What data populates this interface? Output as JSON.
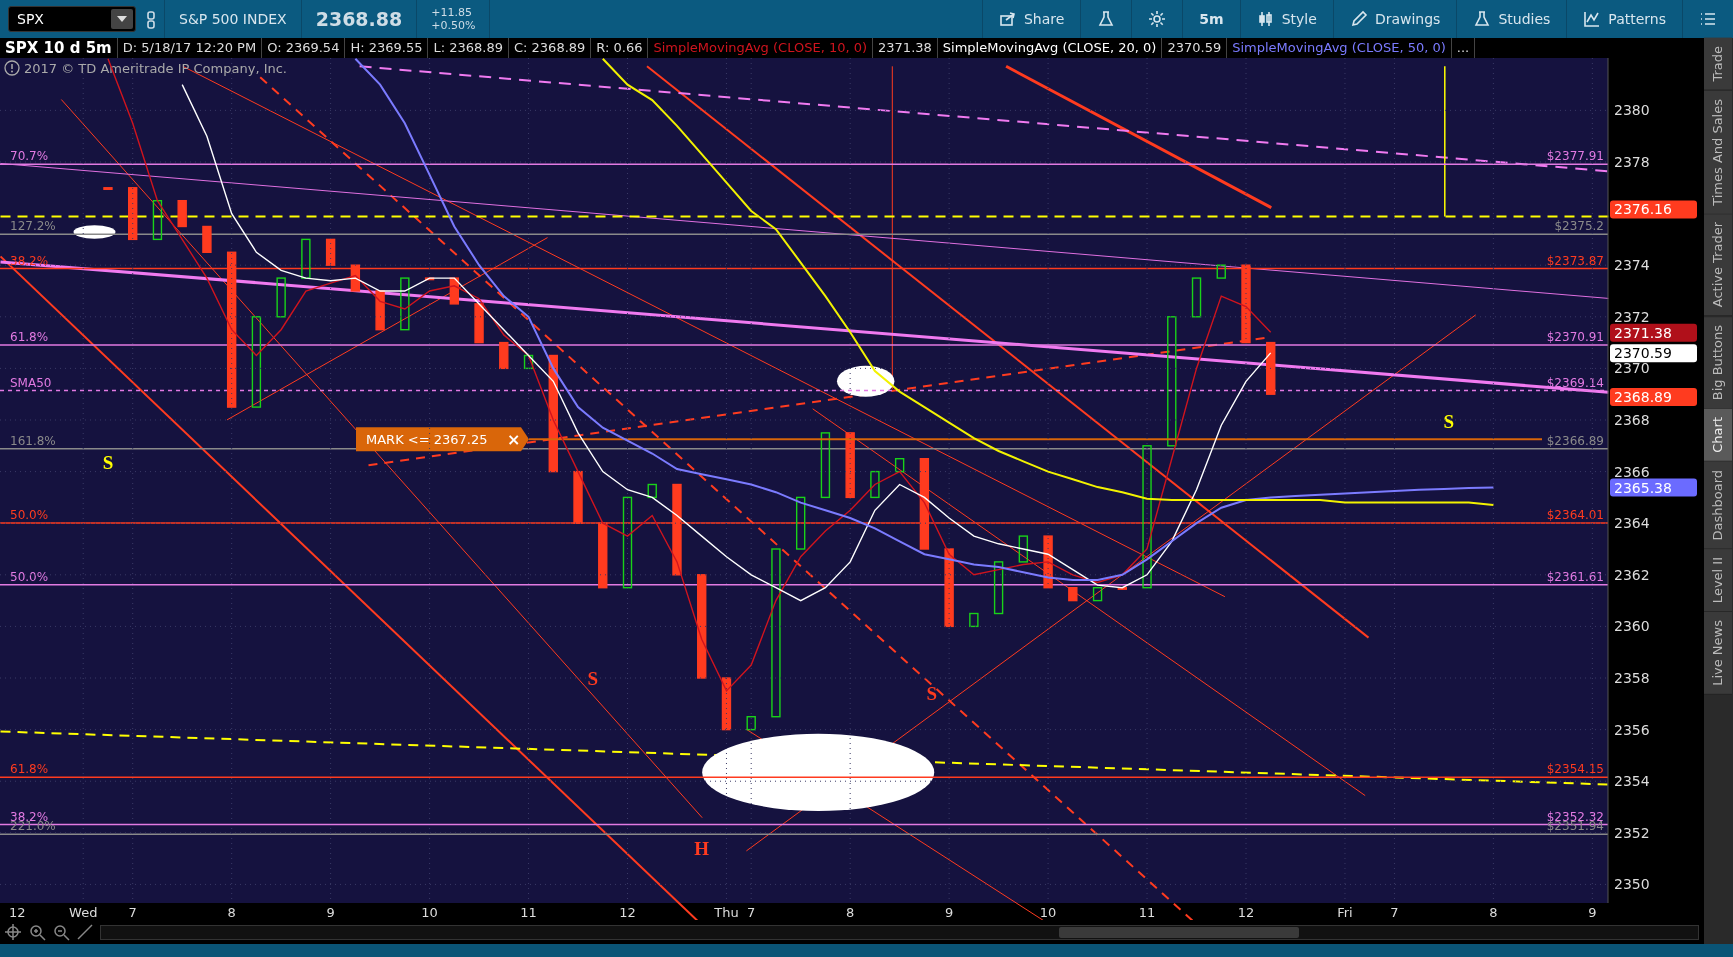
{
  "toolbar": {
    "symbol": "SPX",
    "description": "S&P 500 INDEX",
    "last": "2368.88",
    "change": "+11.85",
    "change_pct": "+0.50%",
    "buttons": [
      {
        "kind": "share",
        "label": "Share"
      },
      {
        "kind": "flask"
      },
      {
        "kind": "gear"
      },
      {
        "kind": "text",
        "label": "5m"
      },
      {
        "kind": "style",
        "label": "Style"
      },
      {
        "kind": "drawings",
        "label": "Drawings"
      },
      {
        "kind": "studies",
        "label": "Studies"
      },
      {
        "kind": "patterns",
        "label": "Patterns"
      },
      {
        "kind": "menu"
      }
    ]
  },
  "legend": {
    "title": "SPX 10 d 5m",
    "fields": [
      "D: 5/18/17 12:20 PM",
      "O: 2369.54",
      "H: 2369.55",
      "L: 2368.89",
      "C: 2368.89",
      "R: 0.66"
    ],
    "studies": [
      {
        "name": "SimpleMovingAvg (CLOSE, 10, 0)",
        "value": "2371.38"
      },
      {
        "name": "SimpleMovingAvg (CLOSE, 20, 0)",
        "value": "2370.59"
      },
      {
        "name": "SimpleMovingAvg (CLOSE, 50, 0)"
      }
    ],
    "more": "..."
  },
  "copyright": "2017 © TD Ameritrade IP Company, Inc.",
  "chart_data": {
    "type": "line",
    "grid": true,
    "ylim": [
      2349.28,
      2382.03
    ],
    "categories": [
      "12",
      null,
      null,
      "Wed",
      null,
      "7",
      null,
      null,
      null,
      "8",
      null,
      null,
      null,
      "9",
      null,
      null,
      null,
      "10",
      null,
      null,
      null,
      "11",
      null,
      null,
      null,
      "12",
      null,
      null,
      null,
      "Thu",
      "7",
      null,
      null,
      null,
      "8",
      null,
      null,
      null,
      "9",
      null,
      null,
      null,
      "10",
      null,
      null,
      null,
      "11",
      null,
      null,
      null,
      "12",
      null,
      null,
      null,
      "Fri",
      null,
      "7",
      null,
      null,
      null,
      "8",
      null,
      null,
      null,
      "9"
    ],
    "series": [
      {
        "color": "#d0141e",
        "values": [
          null,
          null,
          null,
          null,
          2382,
          2379.5,
          2376.5,
          2375,
          2373.5,
          2371.5,
          2370.5,
          2371.5,
          2373,
          2373.3,
          2373.6,
          2372.6,
          2372.3,
          2373,
          2373.2,
          2372.7,
          2371.3,
          2370.5,
          2368,
          2366,
          2364,
          2363.5,
          2364.3,
          2362.5,
          2359.5,
          2357.5,
          2358.5,
          2361,
          2362.7,
          2363.7,
          2364.5,
          2365.5,
          2366,
          2364.8,
          2362.8,
          2362,
          2362.2,
          2362.4,
          2362.5,
          2362,
          2361.7,
          2362,
          2363,
          2366.5,
          2370,
          2372.8,
          2372.4,
          2371.4,
          null,
          null,
          null,
          null,
          null,
          null,
          null,
          null,
          null,
          null,
          null,
          null,
          null
        ]
      },
      {
        "color": "#ffffff",
        "values": [
          null,
          null,
          null,
          null,
          null,
          null,
          null,
          2381,
          2379,
          2376,
          2374.5,
          2373.8,
          2373.5,
          2373.4,
          2373.5,
          2373,
          2373,
          2373.5,
          2373.5,
          2372.5,
          2371.5,
          2370.5,
          2369.5,
          2367.5,
          2366,
          2365.3,
          2365,
          2364.3,
          2363.5,
          2362.7,
          2362,
          2361.5,
          2361,
          2361.5,
          2362.5,
          2364.5,
          2365.5,
          2365,
          2364.2,
          2363.5,
          2363.2,
          2363,
          2362.8,
          2362.2,
          2361.6,
          2361.5,
          2362,
          2363.3,
          2365.3,
          2367.8,
          2369.5,
          2370.6,
          null,
          null,
          null,
          null,
          null,
          null,
          null,
          null,
          null,
          null,
          null,
          null,
          null
        ]
      },
      {
        "color": "#7b7bff",
        "values": [
          null,
          null,
          null,
          null,
          null,
          null,
          null,
          null,
          null,
          null,
          null,
          null,
          null,
          null,
          2382,
          2381,
          2379.5,
          2377.5,
          2375.5,
          2374,
          2372.8,
          2372,
          2370,
          2368.5,
          2367.7,
          2367.2,
          2366.7,
          2366.1,
          2365.9,
          2365.7,
          2365.5,
          2365.2,
          2364.8,
          2364.5,
          2364.2,
          2363.8,
          2363.3,
          2362.8,
          2362.6,
          2362.4,
          2362.3,
          2362.1,
          2361.9,
          2361.8,
          2361.8,
          2362,
          2362.6,
          2363.3,
          2364,
          2364.6,
          2364.9,
          2365,
          2365.05,
          2365.1,
          2365.15,
          2365.2,
          2365.25,
          2365.3,
          2365.33,
          2365.36,
          2365.38,
          null,
          null,
          null,
          null
        ]
      },
      {
        "color": "#f2f200",
        "values": [
          null,
          null,
          null,
          null,
          null,
          null,
          null,
          null,
          null,
          null,
          null,
          null,
          null,
          null,
          null,
          null,
          null,
          null,
          null,
          null,
          null,
          null,
          null,
          null,
          2382,
          2381,
          2380.4,
          2379.4,
          2378.3,
          2377.2,
          2376.1,
          2375.4,
          2374.1,
          2372.8,
          2371.4,
          2369.9,
          2369.1,
          2368.5,
          2367.9,
          2367.3,
          2366.8,
          2366.4,
          2366,
          2365.7,
          2365.4,
          2365.2,
          2364.95,
          2364.9,
          2364.9,
          2364.9,
          2364.9,
          2364.9,
          2364.9,
          2364.9,
          2364.8,
          2364.8,
          2364.8,
          2364.8,
          2364.8,
          2364.8,
          2364.7,
          null,
          null,
          null,
          null
        ]
      }
    ],
    "yticks": [
      2350,
      2352,
      2354,
      2356,
      2358,
      2360,
      2362,
      2364,
      2366,
      2368,
      2370,
      2372,
      2374,
      2378,
      2380
    ]
  },
  "fib_levels": [
    {
      "label": "70.7%",
      "price_label": "$2377.91",
      "color": "#e27ae2"
    },
    {
      "label": "127.2%",
      "price_label": "$2375.2",
      "color": "#8a8a8a"
    },
    {
      "label": "38.2%",
      "price_label": "$2373.87",
      "color": "#ff3b1f"
    },
    {
      "label": "61.8%",
      "price_label": "$2370.91",
      "color": "#e27ae2"
    },
    {
      "label": "SMA50",
      "price_label": "$2369.14",
      "color": "#e27ae2"
    },
    {
      "label": "161.8%",
      "price_label": "$2366.89",
      "color": "#8a8a8a"
    },
    {
      "label": "50.0%",
      "price_label": "$2364.01",
      "color": "#ff3b1f"
    },
    {
      "label": "50.0%",
      "price_label": "$2361.61",
      "color": "#e27ae2"
    },
    {
      "label": "61.8%",
      "price_label": "$2354.15",
      "color": "#ff3b1f"
    },
    {
      "label": "38.2%",
      "price_label": "$2352.32",
      "color": "#e27ae2"
    },
    {
      "label": "221.0%",
      "price_label": "$2351.94",
      "color": "#8a8a8a"
    }
  ],
  "alert": {
    "text": "MARK <= 2367.25",
    "close": "×"
  },
  "pattern_letters": [
    {
      "text": "S",
      "color": "#ffff00"
    },
    {
      "text": "S",
      "color": "#ff3b1f"
    },
    {
      "text": "H",
      "color": "#ff3b1f"
    },
    {
      "text": "S",
      "color": "#ff3b1f"
    },
    {
      "text": "S",
      "color": "#ffff00"
    }
  ],
  "price_tags": [
    {
      "text": "2376.16",
      "color": "#ff3b1f"
    },
    {
      "text": "2371.38",
      "color": "#b0101a"
    },
    {
      "text": "2370.59",
      "color": "#ffffff"
    },
    {
      "text": "2368.89",
      "color": "#ff3b1f"
    },
    {
      "text": "2365.38",
      "color": "#6b6bff"
    }
  ],
  "side_tabs": [
    {
      "label": "Trade",
      "selected": false
    },
    {
      "label": "Times And Sales",
      "selected": false
    },
    {
      "label": "Active Trader",
      "selected": false
    },
    {
      "label": "Big Buttons",
      "selected": false
    },
    {
      "label": "Chart",
      "selected": true
    },
    {
      "label": "Dashboard",
      "selected": false
    },
    {
      "label": "Level II",
      "selected": false
    },
    {
      "label": "Live News",
      "selected": false
    }
  ]
}
